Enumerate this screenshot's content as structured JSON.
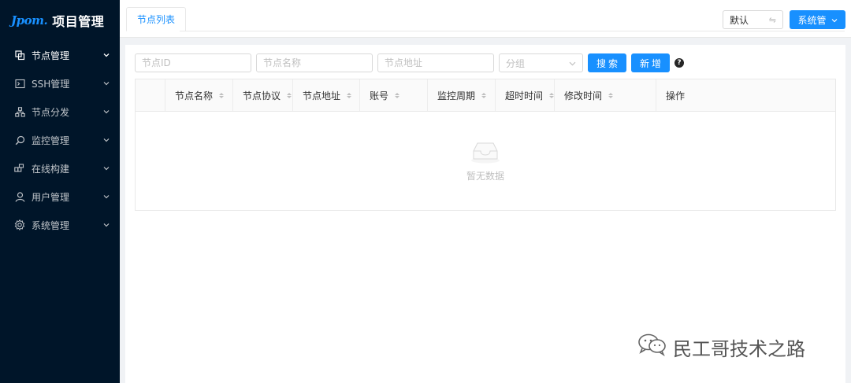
{
  "sidebar": {
    "logo_mark": "Jpom.",
    "title": "项目管理",
    "items": [
      {
        "label": "节点管理",
        "icon": "copy-icon"
      },
      {
        "label": "SSH管理",
        "icon": "terminal-icon"
      },
      {
        "label": "节点分发",
        "icon": "cluster-icon"
      },
      {
        "label": "监控管理",
        "icon": "monitor-search-icon"
      },
      {
        "label": "在线构建",
        "icon": "build-blocks-icon"
      },
      {
        "label": "用户管理",
        "icon": "user-icon"
      },
      {
        "label": "系统管理",
        "icon": "gear-icon"
      }
    ]
  },
  "header": {
    "tab_label": "节点列表",
    "select_value": "默认",
    "system_button": "系统管"
  },
  "toolbar": {
    "node_id_placeholder": "节点ID",
    "node_name_placeholder": "节点名称",
    "node_addr_placeholder": "节点地址",
    "group_placeholder": "分组",
    "search_label": "搜索",
    "add_label": "新增"
  },
  "table": {
    "columns": [
      {
        "label": "",
        "sortable": false
      },
      {
        "label": "节点名称",
        "sortable": true
      },
      {
        "label": "节点协议",
        "sortable": true
      },
      {
        "label": "节点地址",
        "sortable": true
      },
      {
        "label": "账号",
        "sortable": true
      },
      {
        "label": "监控周期",
        "sortable": true
      },
      {
        "label": "超时时间",
        "sortable": true
      },
      {
        "label": "修改时间",
        "sortable": true
      },
      {
        "label": "操作",
        "sortable": false
      }
    ],
    "empty_text": "暂无数据"
  },
  "watermark": {
    "text": "民工哥技术之路"
  },
  "colors": {
    "sidebar_bg": "#001529",
    "primary": "#1890ff",
    "page_bg": "#f0f2f5"
  }
}
